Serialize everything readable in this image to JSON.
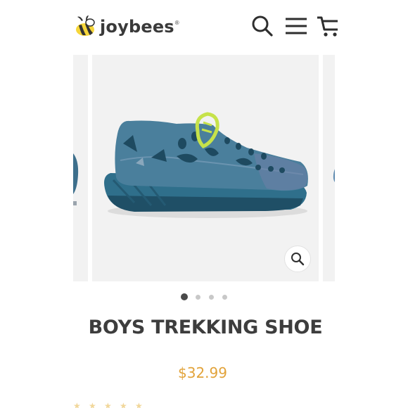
{
  "brand": {
    "name": "joybees",
    "registered_mark": "®",
    "logo_icon": "bee-icon"
  },
  "header": {
    "search_icon": "search-icon",
    "menu_icon": "hamburger-menu-icon",
    "cart_icon": "cart-icon"
  },
  "gallery": {
    "image_count": 4,
    "active_index": 0,
    "zoom_icon": "zoom-icon",
    "product_image": "blue trekking shoe with lime green lace loop"
  },
  "product": {
    "title": "BOYS TREKKING SHOE",
    "price": "$32.99"
  },
  "rating": {
    "star_icon": "star-icon",
    "stars": 5
  },
  "colors": {
    "price": "#e2a33a",
    "text_dark": "#3d3d3d",
    "shoe_blue": "#3f7896",
    "lace_green": "#c6e24a",
    "dot_active": "#4a4a4a",
    "dot_inactive": "#c8c8c8"
  }
}
